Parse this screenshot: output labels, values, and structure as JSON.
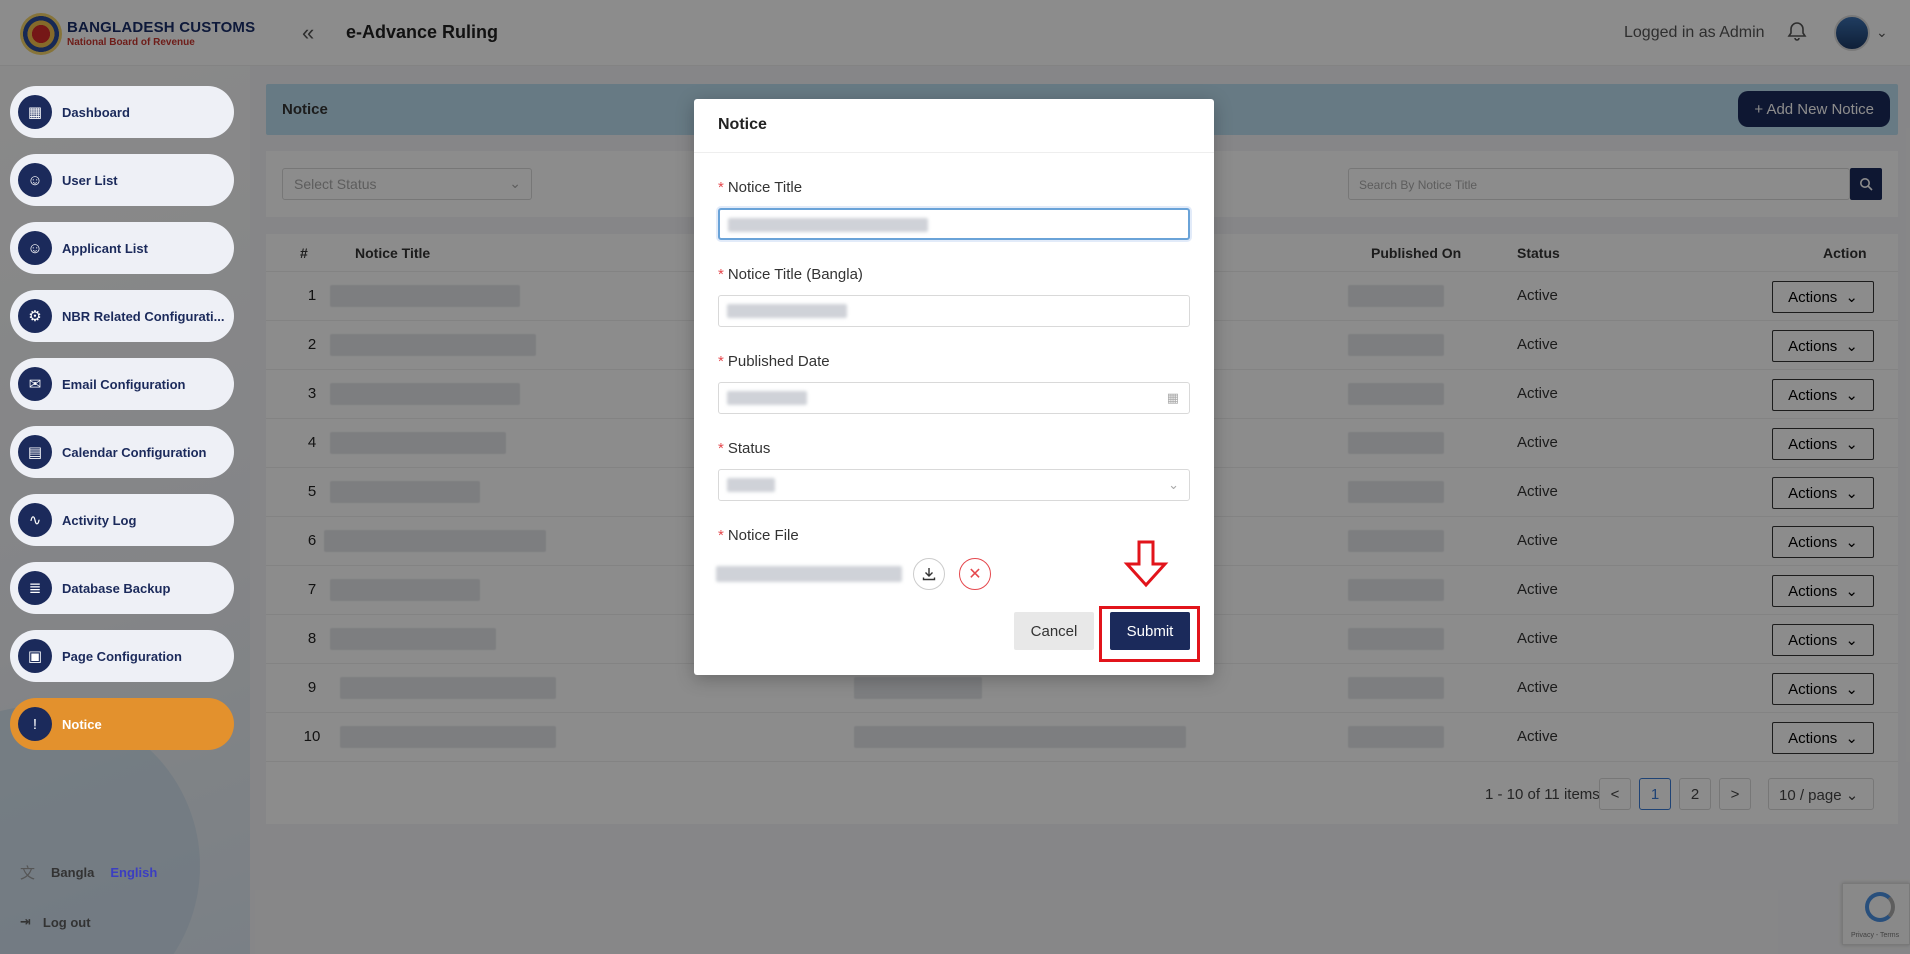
{
  "header": {
    "brand_line1": "BANGLADESH CUSTOMS",
    "brand_line2": "National Board of Revenue",
    "collapse_icon": "«",
    "app_title": "e-Advance Ruling",
    "logged_in": "Logged in as Admin"
  },
  "sidebar": {
    "items": [
      {
        "label": "Dashboard",
        "icon": "▦"
      },
      {
        "label": "User List",
        "icon": "☺"
      },
      {
        "label": "Applicant List",
        "icon": "☺"
      },
      {
        "label": "NBR Related Configurati...",
        "icon": "⚙"
      },
      {
        "label": "Email Configuration",
        "icon": "✉"
      },
      {
        "label": "Calendar Configuration",
        "icon": "▤"
      },
      {
        "label": "Activity Log",
        "icon": "∿"
      },
      {
        "label": "Database Backup",
        "icon": "≣"
      },
      {
        "label": "Page Configuration",
        "icon": "▣"
      },
      {
        "label": "Notice",
        "icon": "!"
      }
    ],
    "lang_bangla": "Bangla",
    "lang_english": "English",
    "translate_icon": "文",
    "logout": "Log out",
    "logout_icon": "⇥"
  },
  "notice_page": {
    "title": "Notice",
    "add_button": "+ Add New Notice",
    "status_placeholder": "Select Status",
    "search_placeholder": "Search By Notice Title",
    "columns": {
      "num": "#",
      "title": "Notice Title",
      "published": "Published On",
      "status": "Status",
      "action": "Action"
    },
    "rows": [
      {
        "num": "1",
        "status": "Active",
        "action": "Actions"
      },
      {
        "num": "2",
        "status": "Active",
        "action": "Actions"
      },
      {
        "num": "3",
        "status": "Active",
        "action": "Actions"
      },
      {
        "num": "4",
        "status": "Active",
        "action": "Actions"
      },
      {
        "num": "5",
        "status": "Active",
        "action": "Actions"
      },
      {
        "num": "6",
        "status": "Active",
        "action": "Actions"
      },
      {
        "num": "7",
        "status": "Active",
        "action": "Actions"
      },
      {
        "num": "8",
        "status": "Active",
        "action": "Actions"
      },
      {
        "num": "9",
        "status": "Active",
        "action": "Actions"
      },
      {
        "num": "10",
        "status": "Active",
        "action": "Actions"
      }
    ],
    "pagination": {
      "summary": "1 - 10 of 11 items",
      "prev": "<",
      "page1": "1",
      "page2": "2",
      "next": ">",
      "per_page": "10 / page"
    }
  },
  "recaptcha": {
    "text": "Privacy - Terms"
  },
  "modal": {
    "title": "Notice",
    "fields": {
      "title_label": "Notice Title",
      "title_bangla_label": "Notice Title (Bangla)",
      "published_label": "Published Date",
      "status_label": "Status",
      "file_label": "Notice File"
    },
    "required_mark": "*",
    "cancel": "Cancel",
    "submit": "Submit",
    "remove_icon": "✕"
  },
  "colors": {
    "primary": "#1b2a5b",
    "active_nav": "#e3912d",
    "highlight": "#e2141b"
  }
}
